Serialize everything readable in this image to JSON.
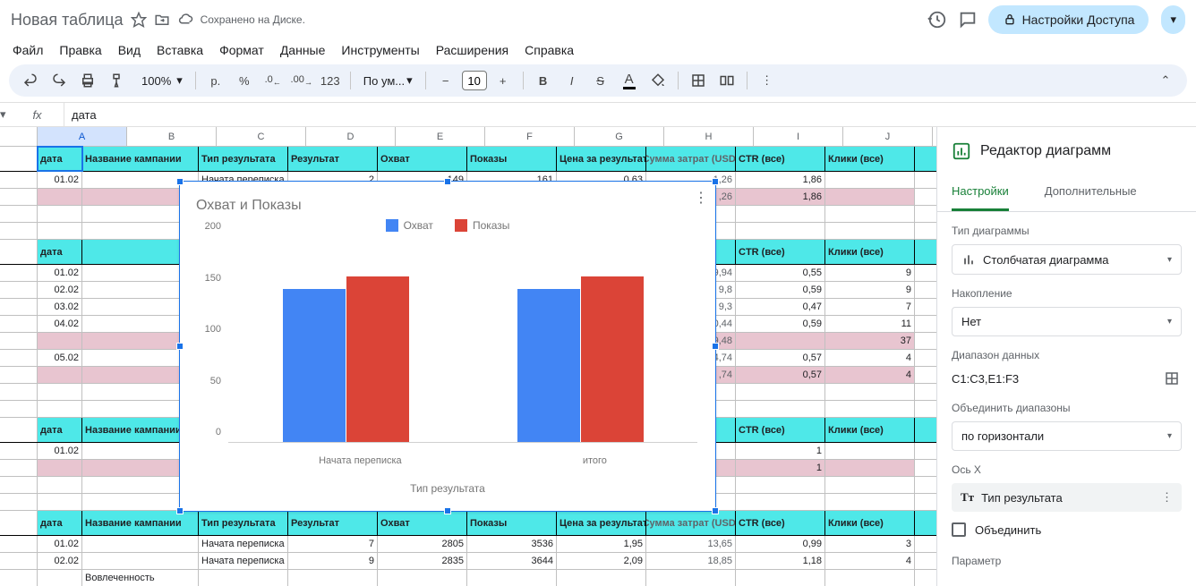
{
  "header": {
    "title": "Новая таблица",
    "saved": "Сохранено на Диске.",
    "share": "Настройки Доступа"
  },
  "menu": [
    "Файл",
    "Правка",
    "Вид",
    "Вставка",
    "Формат",
    "Данные",
    "Инструменты",
    "Расширения",
    "Справка"
  ],
  "toolbar": {
    "zoom": "100%",
    "currency": "р.",
    "percent": "%",
    "dec_dec": ".0",
    "dec_inc": ".00",
    "num_fmt": "123",
    "font": "По ум...",
    "font_size": "10"
  },
  "formula": {
    "label": "fx",
    "value": "дата"
  },
  "columns": [
    "A",
    "B",
    "C",
    "D",
    "E",
    "F",
    "G",
    "H",
    "I",
    "J"
  ],
  "sheet_headers": [
    "дата",
    "Название кампании",
    "Тип результата",
    "Результат",
    "Охват",
    "Показы",
    "Цена за результат",
    "Сумма затрат (USD)",
    "CTR (все)",
    "Клики (все)"
  ],
  "rows": {
    "r1": {
      "date": "01.02",
      "type": "Начата переписка",
      "result": "2",
      "reach": "149",
      "impr": "161",
      "cpr": "0,63",
      "spend": "1,26",
      "ctr": "1,86"
    },
    "r2": {
      "type": "",
      "spend": ",26",
      "ctr": "1,86"
    },
    "r3": {
      "date": "01.02",
      "spend": "9,94",
      "ctr": "0,55",
      "clicks": "9"
    },
    "r4": {
      "date": "02.02",
      "spend": "9,8",
      "ctr": "0,59",
      "clicks": "9"
    },
    "r5": {
      "date": "03.02",
      "spend": "9,3",
      "ctr": "0,47",
      "clicks": "7"
    },
    "r6": {
      "date": "04.02",
      "spend": "0,44",
      "ctr": "0,59",
      "clicks": "11"
    },
    "r7": {
      "spend": "9,48",
      "ctr": "",
      "clicks": "37"
    },
    "r8": {
      "date": "05.02",
      "spend": "4,74",
      "ctr": "0,57",
      "clicks": "4"
    },
    "r9": {
      "spend": ",74",
      "ctr": "0,57",
      "clicks": "4"
    },
    "r10": {
      "date": "01.02",
      "ctr": "1"
    },
    "r11": {
      "ctr": "1"
    },
    "r12": {
      "date": "01.02",
      "type": "Начата переписка",
      "result": "7",
      "reach": "2805",
      "impr": "3536",
      "cpr": "1,95",
      "spend": "13,65",
      "ctr": "0,99",
      "clicks": "3"
    },
    "r13": {
      "date": "02.02",
      "type": "Начата переписка",
      "result": "9",
      "reach": "2835",
      "impr": "3644",
      "cpr": "2,09",
      "spend": "18,85",
      "ctr": "1,18",
      "clicks": "4"
    },
    "r14": {
      "name": "Вовлеченность"
    }
  },
  "partial_header": "т (USD)",
  "chart_data": {
    "type": "bar",
    "title": "Охват и Показы",
    "xlabel": "Тип результата",
    "categories": [
      "Начата переписка",
      "итого"
    ],
    "series": [
      {
        "name": "Охват",
        "values": [
          149,
          149
        ],
        "color": "#4285f4"
      },
      {
        "name": "Показы",
        "values": [
          161,
          161
        ],
        "color": "#db4437"
      }
    ],
    "ylim": [
      0,
      200
    ],
    "yticks": [
      0,
      50,
      100,
      150,
      200
    ]
  },
  "panel": {
    "title": "Редактор диаграмм",
    "tabs": {
      "setup": "Настройки",
      "customize": "Дополнительные"
    },
    "type_label": "Тип диаграммы",
    "type_value": "Столбчатая диаграмма",
    "stacking_label": "Накопление",
    "stacking_value": "Нет",
    "range_label": "Диапазон данных",
    "range_value": "C1:C3,E1:F3",
    "combine_label": "Объединить диапазоны",
    "combine_value": "по горизонтали",
    "xaxis_label": "Ось X",
    "xaxis_value": "Тип результата",
    "aggregate": "Объединить",
    "param_label": "Параметр"
  }
}
